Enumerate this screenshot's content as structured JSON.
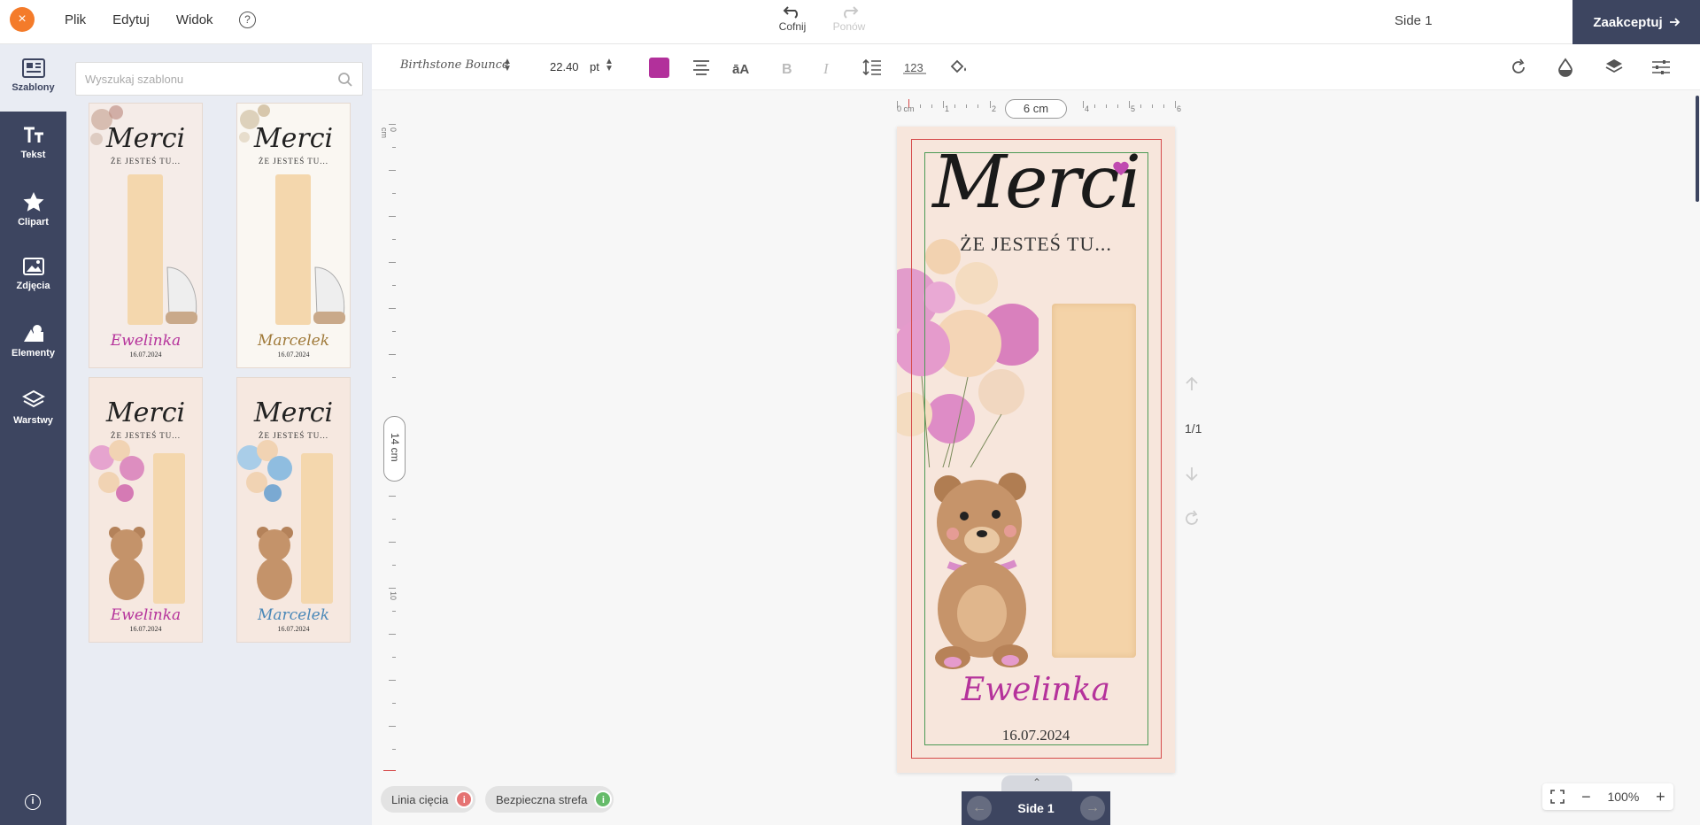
{
  "topbar": {
    "close_glyph": "×",
    "menu": [
      "Plik",
      "Edytuj",
      "Widok"
    ],
    "help_glyph": "?",
    "undo_label": "Cofnij",
    "redo_label": "Ponów",
    "side_title": "Side 1",
    "accept_label": "Zaakceptuj"
  },
  "sidebar": {
    "items": [
      {
        "label": "Szablony",
        "icon": "templates-icon"
      },
      {
        "label": "Tekst",
        "icon": "text-icon"
      },
      {
        "label": "Clipart",
        "icon": "star-icon"
      },
      {
        "label": "Zdjęcia",
        "icon": "image-icon"
      },
      {
        "label": "Elementy",
        "icon": "shapes-icon"
      },
      {
        "label": "Warstwy",
        "icon": "layers-icon"
      }
    ],
    "info_glyph": "i"
  },
  "templates": {
    "search_placeholder": "Wyszukaj szablonu",
    "items": [
      {
        "merci": "Merci",
        "sub": "ŻE JESTEŚ TU...",
        "name": "Ewelinka",
        "date": "16.07.2024",
        "name_color": "#b5329b"
      },
      {
        "merci": "Merci",
        "sub": "ŻE JESTEŚ TU...",
        "name": "Marcelek",
        "date": "16.07.2024",
        "name_color": "#a07a3a"
      },
      {
        "merci": "Merci",
        "sub": "ŻE JESTEŚ TU...",
        "name": "Ewelinka",
        "date": "16.07.2024",
        "name_color": "#b5329b"
      },
      {
        "merci": "Merci",
        "sub": "ŻE JESTEŚ TU...",
        "name": "Marcelek",
        "date": "16.07.2024",
        "name_color": "#4a88b8"
      }
    ]
  },
  "toolbar": {
    "font_name": "Birthstone Bounce",
    "font_size": "22.40",
    "font_unit": "pt",
    "text_color": "#b2309b"
  },
  "rulers": {
    "h_labels": [
      "0 cm",
      "1",
      "2",
      "4",
      "5",
      "6"
    ],
    "h_bubble": "6 cm",
    "v_labels": [
      "0 cm",
      "10"
    ],
    "v_bubble": "14 cm"
  },
  "card": {
    "merci": "Merci",
    "sub": "ŻE JESTEŚ TU...",
    "name": "Ewelinka",
    "date": "16.07.2024"
  },
  "page_controls": {
    "count": "1/1"
  },
  "bottom": {
    "cut_line_label": "Linia cięcia",
    "safe_zone_label": "Bezpieczna strefa",
    "page_label": "Side 1",
    "zoom": "100%",
    "cut_color": "#e57373",
    "safe_color": "#66bb6a"
  }
}
